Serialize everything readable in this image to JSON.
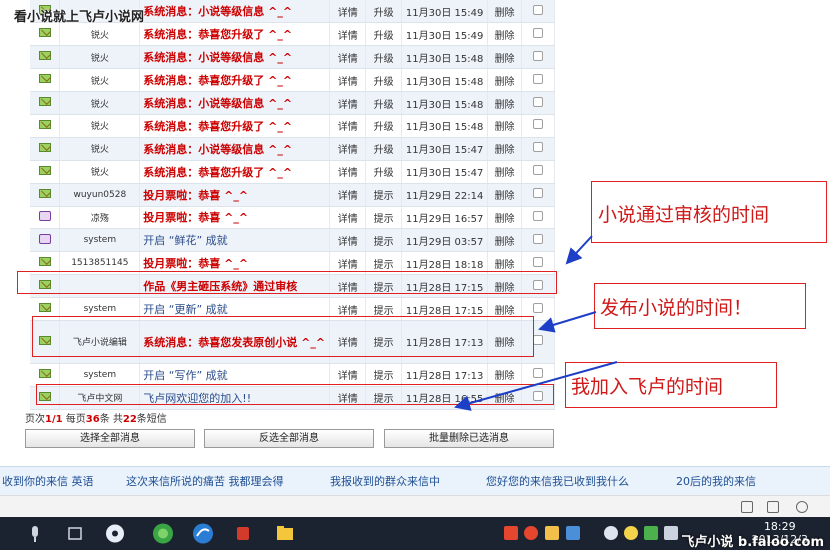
{
  "watermark_top": "看小说就上飞卢小说网",
  "columns": {
    "detail": "详情",
    "delete": "删除"
  },
  "messages": [
    {
      "icon": "read",
      "sender": "",
      "title": "系统消息：小说等级信息 ^_^",
      "bold": true,
      "type": "升级",
      "time": "11月30日 15:49"
    },
    {
      "icon": "read",
      "sender": "锐火",
      "title": "系统消息：恭喜您升级了 ^_^",
      "bold": true,
      "type": "升级",
      "time": "11月30日 15:49"
    },
    {
      "icon": "read",
      "sender": "锐火",
      "title": "系统消息：小说等级信息 ^_^",
      "bold": true,
      "type": "升级",
      "time": "11月30日 15:48"
    },
    {
      "icon": "read",
      "sender": "锐火",
      "title": "系统消息：恭喜您升级了 ^_^",
      "bold": true,
      "type": "升级",
      "time": "11月30日 15:48"
    },
    {
      "icon": "read",
      "sender": "锐火",
      "title": "系统消息：小说等级信息 ^_^",
      "bold": true,
      "type": "升级",
      "time": "11月30日 15:48"
    },
    {
      "icon": "read",
      "sender": "锐火",
      "title": "系统消息：恭喜您升级了 ^_^",
      "bold": true,
      "type": "升级",
      "time": "11月30日 15:48"
    },
    {
      "icon": "read",
      "sender": "锐火",
      "title": "系统消息：小说等级信息 ^_^",
      "bold": true,
      "type": "升级",
      "time": "11月30日 15:47"
    },
    {
      "icon": "read",
      "sender": "锐火",
      "title": "系统消息：恭喜您升级了 ^_^",
      "bold": true,
      "type": "升级",
      "time": "11月30日 15:47"
    },
    {
      "icon": "read",
      "sender": "wuyun0528",
      "title": "投月票啦：恭喜 ^_^",
      "bold": true,
      "type": "提示",
      "time": "11月29日 22:14"
    },
    {
      "icon": "group",
      "sender": "凉殇",
      "title": "投月票啦：恭喜 ^_^",
      "bold": true,
      "type": "提示",
      "time": "11月29日 16:57"
    },
    {
      "icon": "group",
      "sender": "system",
      "title": "开启 “鲜花” 成就",
      "bold": false,
      "type": "提示",
      "time": "11月29日 03:57"
    },
    {
      "icon": "read",
      "sender": "1513851145",
      "title": "投月票啦：恭喜 ^_^",
      "bold": true,
      "type": "提示",
      "time": "11月28日 18:18"
    },
    {
      "icon": "read",
      "sender": "",
      "title": "作品《男主砸压系统》通过审核",
      "bold": true,
      "type": "提示",
      "time": "11月28日 17:15"
    },
    {
      "icon": "read",
      "sender": "system",
      "title": "开启 “更新” 成就",
      "bold": false,
      "type": "提示",
      "time": "11月28日 17:15"
    },
    {
      "icon": "read",
      "sender": "飞卢小说编辑",
      "title": "系统消息：恭喜您发表原创小说 ^_^",
      "bold": true,
      "type": "提示",
      "time": "11月28日 17:13"
    },
    {
      "icon": "read",
      "sender": "system",
      "title": "开启 “写作” 成就",
      "bold": false,
      "type": "提示",
      "time": "11月28日 17:13"
    },
    {
      "icon": "read",
      "sender": "飞卢中文网",
      "title": "飞卢网欢迎您的加入!!",
      "bold": false,
      "type": "提示",
      "time": "11月28日 16:55"
    }
  ],
  "pager": {
    "prefix": "页次",
    "page": "1/1",
    "per_page_label": "每页",
    "per_page": "36",
    "per_page_unit": "条",
    "total_label": "共",
    "total": "22",
    "total_unit": "条短信"
  },
  "buttons": {
    "select_all": "选择全部消息",
    "invert": "反选全部消息",
    "bulk_delete": "批量删除已选消息"
  },
  "annotations": {
    "review_time": "小说通过审核的时间",
    "publish_time": "发布小说的时间！",
    "join_time": "我加入飞卢的时间"
  },
  "news": [
    "收到你的来信 英语",
    "这次来信所说的痛苦 我都理会得",
    "我报收到的群众来信中",
    "您好您的来信我已收到我什么",
    "20后的我的来信"
  ],
  "clock": {
    "time": "18:29",
    "date": "2013/12/3"
  },
  "site_watermark": "飞卢小说 b.faloo.com"
}
